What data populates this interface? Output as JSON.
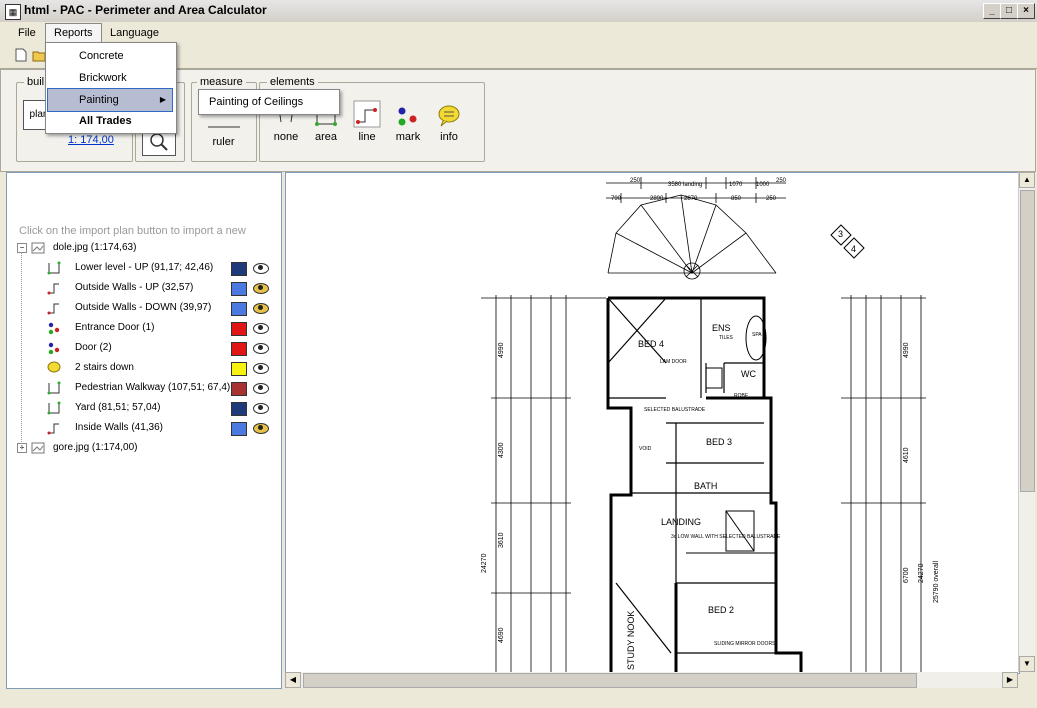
{
  "window": {
    "title": "html - PAC - Perimeter and Area Calculator",
    "controls": {
      "minimize": "_",
      "maximize": "□",
      "close": "×"
    }
  },
  "menubar": {
    "file": "File",
    "reports": "Reports",
    "language": "Language"
  },
  "reports_menu": {
    "items": [
      "Concrete",
      "Brickwork",
      "Painting",
      "All Trades"
    ],
    "painting_submenu": [
      "Painting of Ceilings"
    ]
  },
  "ribbon": {
    "build_group": "buil",
    "plan_button": "plan",
    "scale_link": "1: 174,00",
    "measure_group": "measure",
    "ruler": "ruler",
    "elements_group": "elements",
    "tools": [
      "none",
      "area",
      "line",
      "mark",
      "info"
    ]
  },
  "left_panel": {
    "hint": "Click on the import plan button to import a new",
    "tree": [
      {
        "label": "dole.jpg (1:174,63)",
        "level": 0,
        "expanded": true,
        "icon": "image-icon"
      },
      {
        "label": "Lower level - UP (91,17; 42,46)",
        "level": 1,
        "icon": "area-icon",
        "color": "#1f3a78",
        "eye": "normal"
      },
      {
        "label": "Outside Walls - UP (32,57)",
        "level": 1,
        "icon": "line-icon",
        "color": "#4a7adf",
        "eye": "gold"
      },
      {
        "label": "Outside Walls - DOWN (39,97)",
        "level": 1,
        "icon": "line-icon",
        "color": "#4a7adf",
        "eye": "gold"
      },
      {
        "label": "Entrance Door (1)",
        "level": 1,
        "icon": "mark-icon",
        "color": "#e01616",
        "eye": "normal"
      },
      {
        "label": "Door (2)",
        "level": 1,
        "icon": "mark-icon",
        "color": "#e01616",
        "eye": "normal"
      },
      {
        "label": "2 stairs down",
        "level": 1,
        "icon": "info-icon",
        "color": "#f7f20f",
        "eye": "normal"
      },
      {
        "label": "Pedestrian Walkway (107,51; 67,4)",
        "level": 1,
        "icon": "area-icon",
        "color": "#a83232",
        "eye": "normal"
      },
      {
        "label": "Yard (81,51; 57,04)",
        "level": 1,
        "icon": "area-icon",
        "color": "#1f3a78",
        "eye": "normal"
      },
      {
        "label": "Inside Walls (41,36)",
        "level": 1,
        "icon": "line-icon",
        "color": "#4a7adf",
        "eye": "gold"
      },
      {
        "label": "gore.jpg (1:174,00)",
        "level": 0,
        "expanded": false,
        "icon": "image-icon"
      }
    ]
  },
  "plan": {
    "rooms": [
      "BED 4",
      "ENS",
      "WC",
      "BED 3",
      "BATH",
      "LANDING",
      "BED 2",
      "STUDY NOOK"
    ],
    "labels": {
      "tiles": "TILES",
      "spa": "SPA",
      "void": "VOID",
      "robe": "ROBE",
      "lam_door": "LAM DOOR",
      "selected_balustrade": "SELECTED BALUSTRADE",
      "low_wall": "3c LOW WALL WITH SELECTED BALUSTRADE",
      "sliding_mirror": "SLIDING MIRROR DOORS",
      "overall": "25790 overall"
    },
    "dimensions": {
      "left": [
        "4990",
        "4300",
        "3610",
        "4690",
        "24270"
      ],
      "right": [
        "4990",
        "4610",
        "6700",
        "24270"
      ],
      "top": [
        "250",
        "3580 landing",
        "1070",
        "1000",
        "250",
        "790",
        "2890",
        "2870",
        "850",
        "250"
      ]
    },
    "markers": [
      "3",
      "4"
    ]
  }
}
